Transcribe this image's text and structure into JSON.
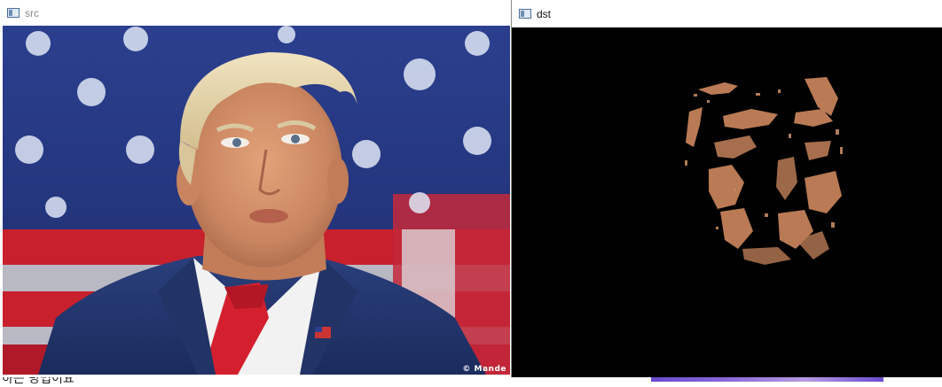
{
  "src_window": {
    "title": "src",
    "credit": "© Mande"
  },
  "dst_window": {
    "title": "dst"
  },
  "background": {
    "partial_text": "하는 방법이요"
  },
  "colors": {
    "titlebar": "#ffffff",
    "dst_background": "#000000",
    "skin": "#b97a55"
  }
}
